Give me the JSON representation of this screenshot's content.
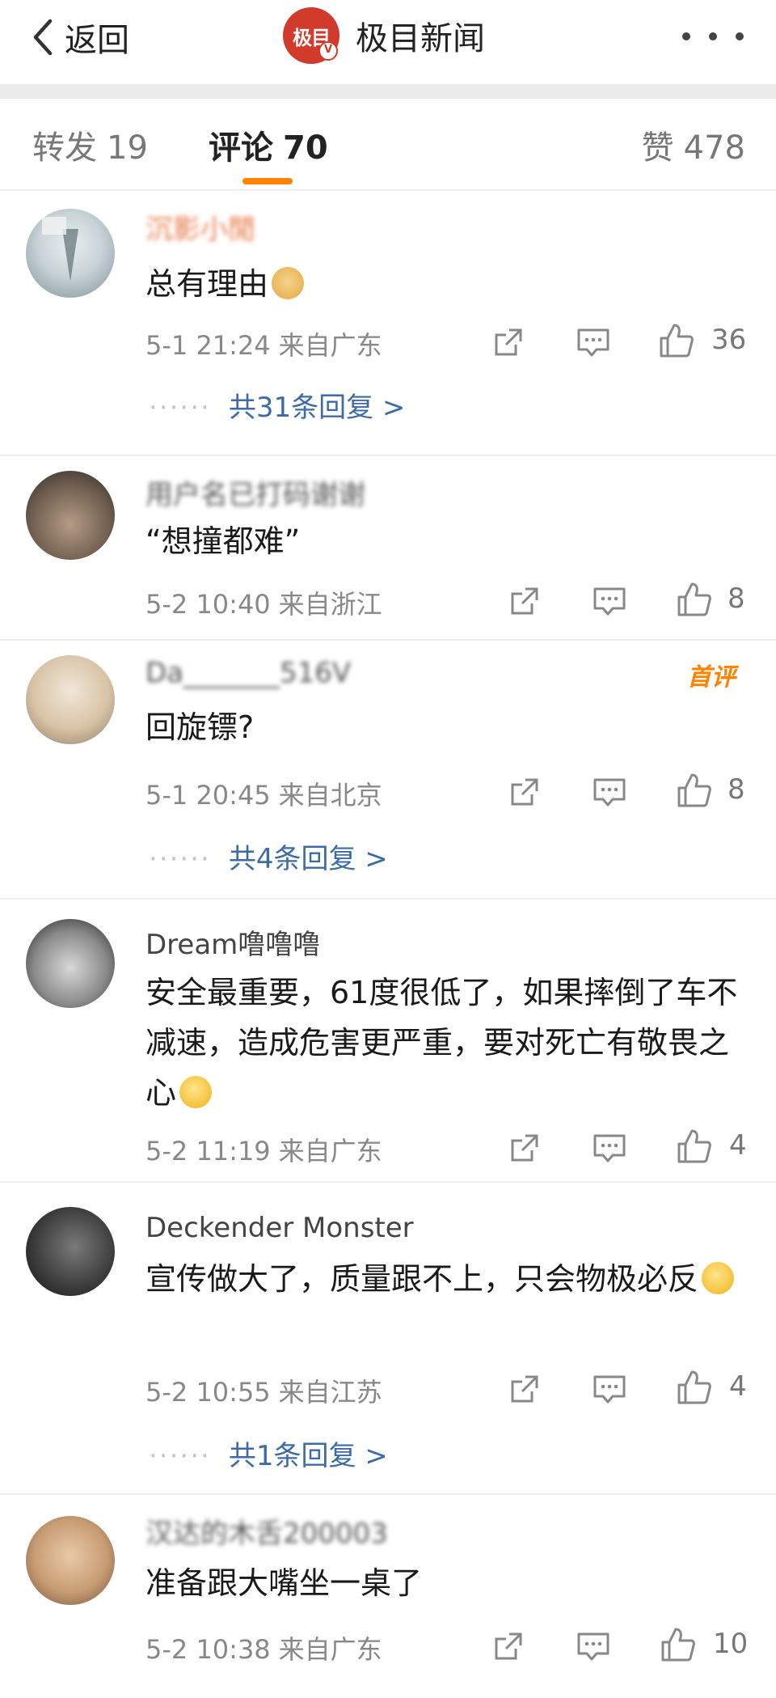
{
  "header": {
    "back_label": "返回",
    "title": "极目新闻",
    "logo_text": "极目",
    "logo_badge": "V",
    "accent_color": "#d23a2c"
  },
  "tabs": {
    "repost": {
      "label": "转发",
      "count": "19"
    },
    "comment": {
      "label": "评论",
      "count": "70"
    },
    "like": {
      "label": "赞",
      "count": "478"
    },
    "active_color": "#ff8200"
  },
  "comments": [
    {
      "username": "沉影小閒",
      "content": "总有理由",
      "emoji": "doge",
      "date": "5-1 21:24",
      "location": "来自广东",
      "likes": "36",
      "replies": "共31条回复 >",
      "badge": ""
    },
    {
      "username": "用户名已打码谢谢",
      "content": "“想撞都难”",
      "emoji": "",
      "date": "5-2 10:40",
      "location": "来自浙江",
      "likes": "8",
      "replies": "",
      "badge": ""
    },
    {
      "username": "Da_______516V",
      "content": "回旋镖?",
      "emoji": "",
      "date": "5-1 20:45",
      "location": "来自北京",
      "likes": "8",
      "replies": "共4条回复 >",
      "badge": "首评"
    },
    {
      "username": "Dream噜噜噜",
      "content": "安全最重要，61度很低了，如果摔倒了车不减速，造成危害更严重，要对死亡有敬畏之心",
      "emoji": "thinking",
      "date": "5-2 11:19",
      "location": "来自广东",
      "likes": "4",
      "replies": "",
      "badge": ""
    },
    {
      "username": "Deckender Monster",
      "content": "宣传做大了，质量跟不上，只会物极必反",
      "emoji": "smirk",
      "date": "5-2 10:55",
      "location": "来自江苏",
      "likes": "4",
      "replies": "共1条回复 >",
      "badge": ""
    },
    {
      "username": "汉达的木舌200003",
      "content": "准备跟大嘴坐一桌了",
      "emoji": "",
      "date": "5-2 10:38",
      "location": "来自广东",
      "likes": "10",
      "replies": "",
      "badge": ""
    }
  ]
}
